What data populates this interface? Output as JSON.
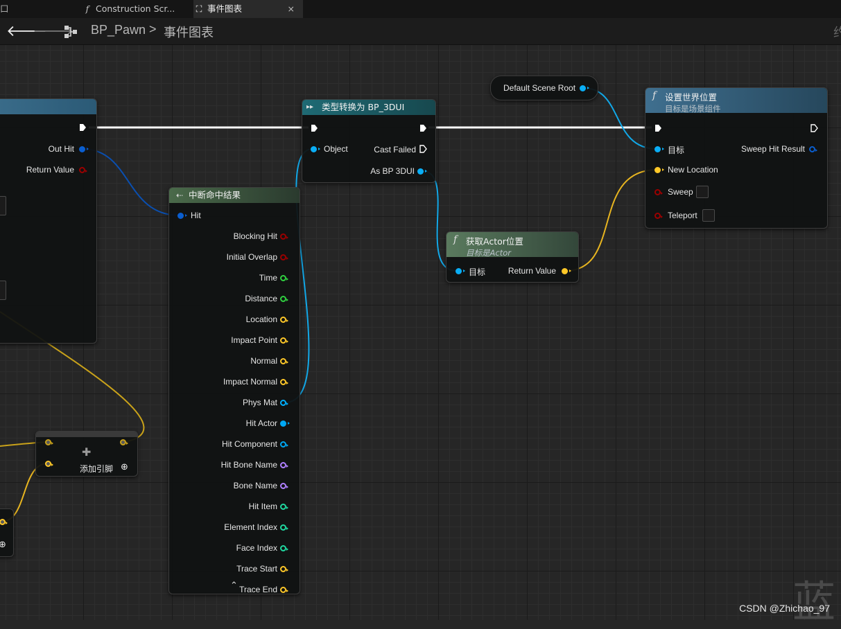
{
  "tabs": [
    {
      "label": "口",
      "icon": ""
    },
    {
      "label": "Construction Scr...",
      "icon": "function-icon"
    },
    {
      "label": "事件图表",
      "icon": "event-graph-icon",
      "close": "×"
    }
  ],
  "breadcrumb": {
    "root": "BP_Pawn",
    "sep": ">",
    "current": "事件图表",
    "overflow": "约"
  },
  "nodes": {
    "break_hit": {
      "title": "中断命中结果",
      "pin_in": "Hit",
      "pins_out": [
        "Blocking Hit",
        "Initial Overlap",
        "Time",
        "Distance",
        "Location",
        "Impact Point",
        "Normal",
        "Impact Normal",
        "Phys Mat",
        "Hit Actor",
        "Hit Component",
        "Hit Bone Name",
        "Bone Name",
        "Hit Item",
        "Element Index",
        "Face Index",
        "Trace Start",
        "Trace End"
      ],
      "collapse": "⌃"
    },
    "cast": {
      "title": "类型转换为 BP_3DUI",
      "pin_object": "Object",
      "pin_failed": "Cast Failed",
      "pin_as": "As BP 3DUI"
    },
    "scene_root": {
      "label": "Default Scene Root"
    },
    "set_world_loc": {
      "title": "设置世界位置",
      "subtitle": "目标是场景组件",
      "pins_in": [
        "目标",
        "New Location",
        "Sweep",
        "Teleport"
      ],
      "pin_out": "Sweep Hit Result"
    },
    "get_actor_loc": {
      "title": "获取Actor位置",
      "subtitle": "目标是Actor",
      "pin_in": "目标",
      "pin_out": "Return Value"
    },
    "left_partial": {
      "pin_out_hit": "Out Hit",
      "pin_return": "Return Value"
    },
    "make_array": {
      "add_pin": "添加引脚"
    }
  },
  "colors": {
    "exec": "#ffffff",
    "object": "#00a8f4",
    "vector": "#ffc828",
    "struct": "#0060d0",
    "bool": "#9c0000",
    "float": "#30d040",
    "name": "#b080ff",
    "int": "#20d8a0",
    "material": "#00b0ff"
  },
  "watermark": "CSDN @Zhichao_97",
  "bg_char": "蓝"
}
